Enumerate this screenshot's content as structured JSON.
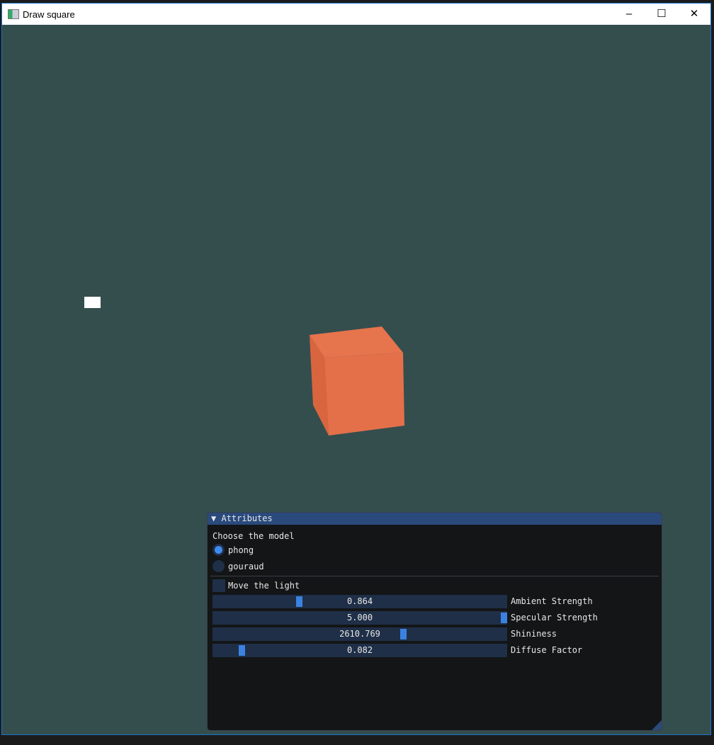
{
  "window": {
    "title": "Draw square",
    "minimize": "–",
    "maximize": "☐",
    "close": "✕"
  },
  "colors": {
    "background": "#344e4e",
    "cube": "#e4704a",
    "accent": "#3b82e0"
  },
  "panel": {
    "title": "Attributes",
    "collapse_icon": "▼",
    "model_label": "Choose the model",
    "models": [
      {
        "label": "phong",
        "selected": true
      },
      {
        "label": "gouraud",
        "selected": false
      }
    ],
    "move_light": {
      "label": "Move the light",
      "checked": false
    },
    "sliders": [
      {
        "label": "Ambient Strength",
        "value": "0.864",
        "fraction": 0.29
      },
      {
        "label": "Specular Strength",
        "value": "5.000",
        "fraction": 1.0
      },
      {
        "label": "Shininess",
        "value": "2610.769",
        "fraction": 0.65
      },
      {
        "label": "Diffuse Factor",
        "value": "0.082",
        "fraction": 0.09
      }
    ]
  }
}
